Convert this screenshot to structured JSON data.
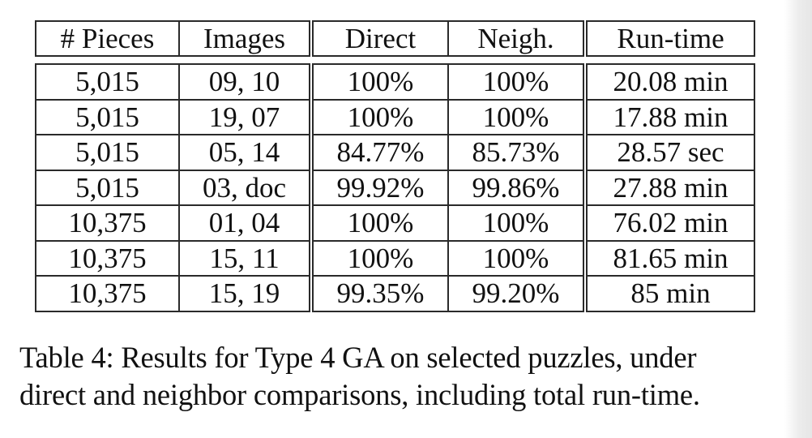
{
  "table": {
    "headers": [
      "# Pieces",
      "Images",
      "Direct",
      "Neigh.",
      "Run-time"
    ],
    "rows": [
      [
        "5,015",
        "09, 10",
        "100%",
        "100%",
        "20.08 min"
      ],
      [
        "5,015",
        "19, 07",
        "100%",
        "100%",
        "17.88 min"
      ],
      [
        "5,015",
        "05, 14",
        "84.77%",
        "85.73%",
        "28.57 sec"
      ],
      [
        "5,015",
        "03, doc",
        "99.92%",
        "99.86%",
        "27.88 min"
      ],
      [
        "10,375",
        "01, 04",
        "100%",
        "100%",
        "76.02 min"
      ],
      [
        "10,375",
        "15, 11",
        "100%",
        "100%",
        "81.65 min"
      ],
      [
        "10,375",
        "15, 19",
        "99.35%",
        "99.20%",
        "85 min"
      ]
    ]
  },
  "caption": {
    "line1": "Table 4: Results for Type 4 GA on selected puzzles, under",
    "line2": "direct and neighbor comparisons, including total run-time."
  }
}
